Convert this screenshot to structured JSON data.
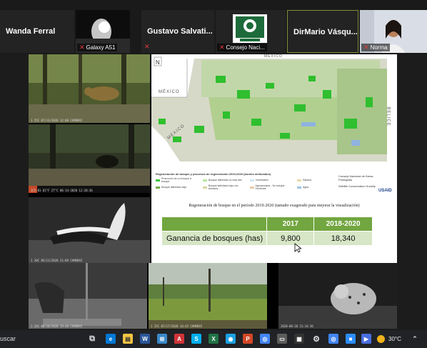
{
  "participants": [
    {
      "name": "Wanda Ferral",
      "tag": ""
    },
    {
      "name": "",
      "tag": "Galaxy A51"
    },
    {
      "name": "Gustavo Salvati...",
      "tag": ""
    },
    {
      "name": "",
      "tag": "Consejo Naci..."
    },
    {
      "name": "DirMario Vásqu...",
      "tag": ""
    },
    {
      "name": "",
      "tag": "Norma"
    }
  ],
  "camera_stamps": [
    "1 25C    07/13/2020  12:00   CAMERA5",
    "IC5-01      61°F 27°C     06-14-2020   12:28:36",
    "1 20C    05/11/2020  21:09   CAMERA5",
    "1 24C    06/10/2020  19:40   CAMERA5",
    "1 25C    07/17/2020  14:45   CAMERA5",
    "2020-08-28   21:14:36"
  ],
  "slide": {
    "map_labels": {
      "mexico_top": "MÉXICO",
      "mexico_left": "MÉXICO",
      "mexico_lower": "MÉXICO",
      "belice": "BELICE"
    },
    "legend_title": "Regeneración de bosque y procesos de regeneración 2019-2020 (bordes delineados)",
    "legend_items": [
      {
        "label": "Promoción de no bosque a bosque",
        "color": "#3cc63c"
      },
      {
        "label": "Bosque latifoliado no más alto",
        "color": "#b7e6a1"
      },
      {
        "label": "Bosque latifoliado bajo",
        "color": "#6fae4f"
      },
      {
        "label": "Bosque latifoliado bajo con arbustos",
        "color": "#d7d7a0"
      },
      {
        "label": "Humedales",
        "color": "#cfe9f5"
      },
      {
        "label": "Sabana",
        "color": "#e9d8a6"
      },
      {
        "label": "Agropecuaria - No bosque - Humedos",
        "color": "#e7c9a9"
      },
      {
        "label": "Agua",
        "color": "#9ec3e6"
      }
    ],
    "logos": [
      "Consejo Nacional de Áreas Protegidas",
      "Wildlife Conservation Society",
      "USAID"
    ],
    "caption": "Regeneración de bosque en el período 2019-2020 (tamaño exagerado para mejorar la visualización)",
    "table": {
      "headers": [
        "",
        "2017",
        "2018-2020"
      ],
      "rows": [
        [
          "Ganancia de bosques (has)",
          "9,800",
          "18,340"
        ]
      ]
    }
  },
  "taskbar": {
    "search_text": "uscar",
    "temperature": "30°C"
  }
}
